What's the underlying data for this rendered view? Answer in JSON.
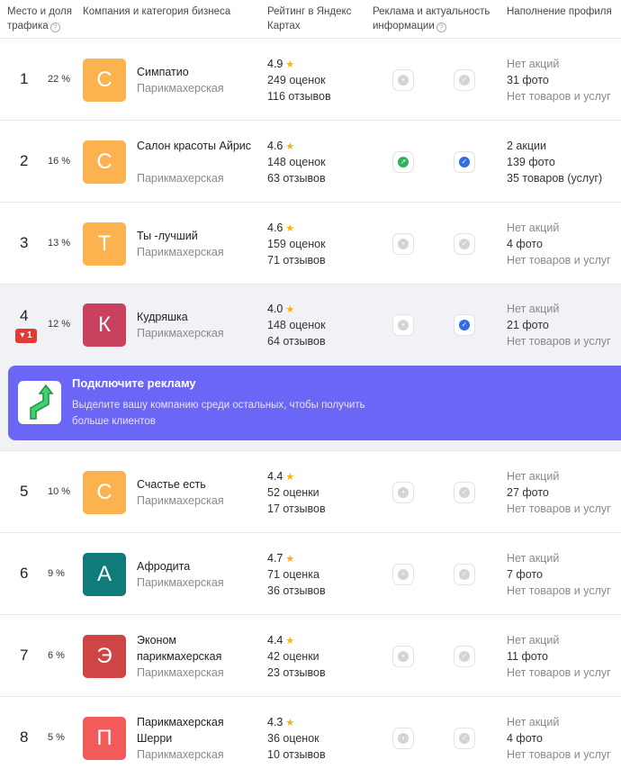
{
  "header": {
    "col_place": "Место и доля трафика",
    "col_company": "Компания и категория бизнеса",
    "col_rating": "Рейтинг в Яндекс Картах",
    "col_ads": "Реклама и актуальность информации",
    "col_profile": "Наполнение профиля",
    "help_glyph": "?"
  },
  "rows": [
    {
      "rank": "1",
      "share": "22 %",
      "letter": "С",
      "avatar_color": "#fbb24f",
      "name": "Симпатио",
      "category": "Парикмахерская",
      "rating": "4.9",
      "ratings_count": "249 оценок",
      "reviews_count": "116 отзывов",
      "ads_active": false,
      "info_actual": false,
      "promos": "Нет акций",
      "photos": "31 фото",
      "goods": "Нет товаров и услуг"
    },
    {
      "rank": "2",
      "share": "16 %",
      "letter": "С",
      "avatar_color": "#fbb24f",
      "name": "Салон красоты Айрис",
      "category": "Парикмахерская",
      "rating": "4.6",
      "ratings_count": "148 оценок",
      "reviews_count": "63 отзывов",
      "ads_active": true,
      "info_actual": true,
      "promos": "2 акции",
      "photos": "139 фото",
      "goods": "35 товаров (услуг)"
    },
    {
      "rank": "3",
      "share": "13 %",
      "letter": "Т",
      "avatar_color": "#fbb24f",
      "name": "Ты -лучший",
      "category": "Парикмахерская",
      "rating": "4.6",
      "ratings_count": "159 оценок",
      "reviews_count": "71 отзывов",
      "ads_active": false,
      "info_actual": false,
      "promos": "Нет акций",
      "photos": "4 фото",
      "goods": "Нет товаров и услуг"
    },
    {
      "rank": "4",
      "share": "12 %",
      "letter": "К",
      "avatar_color": "#c9415f",
      "name": "Кудряшка",
      "category": "Парикмахерская",
      "rating": "4.0",
      "ratings_count": "148 оценок",
      "reviews_count": "64 отзывов",
      "ads_active": false,
      "info_actual": true,
      "promos": "Нет акций",
      "photos": "21 фото",
      "goods": "Нет товаров и услуг",
      "rank_change": "▾ 1"
    },
    {
      "rank": "5",
      "share": "10 %",
      "letter": "С",
      "avatar_color": "#fbb24f",
      "name": "Счастье есть",
      "category": "Парикмахерская",
      "rating": "4.4",
      "ratings_count": "52 оценки",
      "reviews_count": "17 отзывов",
      "ads_active": false,
      "info_actual": false,
      "promos": "Нет акций",
      "photos": "27 фото",
      "goods": "Нет товаров и услуг"
    },
    {
      "rank": "6",
      "share": "9 %",
      "letter": "А",
      "avatar_color": "#0f7b7b",
      "name": "Афродита",
      "category": "Парикмахерская",
      "rating": "4.7",
      "ratings_count": "71 оценка",
      "reviews_count": "36 отзывов",
      "ads_active": false,
      "info_actual": false,
      "promos": "Нет акций",
      "photos": "7 фото",
      "goods": "Нет товаров и услуг"
    },
    {
      "rank": "7",
      "share": "6 %",
      "letter": "Э",
      "avatar_color": "#cf4545",
      "name": "Эконом парикмахерская",
      "category": "Парикмахерская",
      "rating": "4.4",
      "ratings_count": "42 оценки",
      "reviews_count": "23 отзывов",
      "ads_active": false,
      "info_actual": false,
      "promos": "Нет акций",
      "photos": "11 фото",
      "goods": "Нет товаров и услуг"
    },
    {
      "rank": "8",
      "share": "5 %",
      "letter": "П",
      "avatar_color": "#f35a5a",
      "name": "Парикмахерская Шерри",
      "category": "Парикмахерская",
      "rating": "4.3",
      "ratings_count": "36 оценок",
      "reviews_count": "10 отзывов",
      "ads_active": false,
      "info_actual": false,
      "promos": "Нет акций",
      "photos": "4 фото",
      "goods": "Нет товаров и услуг"
    }
  ],
  "promo": {
    "title": "Подключите рекламу",
    "text": "Выделите вашу компанию среди остальных, чтобы получить больше клиентов"
  },
  "icons": {
    "star": "★",
    "ads_active_glyph": "↗",
    "check_glyph": "✓",
    "inactive_glyph": "•"
  }
}
